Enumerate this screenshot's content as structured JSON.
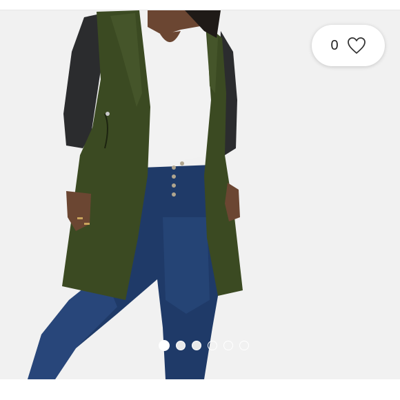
{
  "listing": {
    "like_count": "0"
  },
  "carousel": {
    "dot_count": 6,
    "active_index": 0
  },
  "icons": {
    "like": "heart-outline-icon"
  },
  "colors": {
    "coat": "#3b4a22",
    "sleeves": "#2b2c2e",
    "jeans": "#1f3a68",
    "tee": "#f2f2f2",
    "skin": "#6b4632",
    "hair": "#1f1a17",
    "background": "#f3f3f3"
  }
}
